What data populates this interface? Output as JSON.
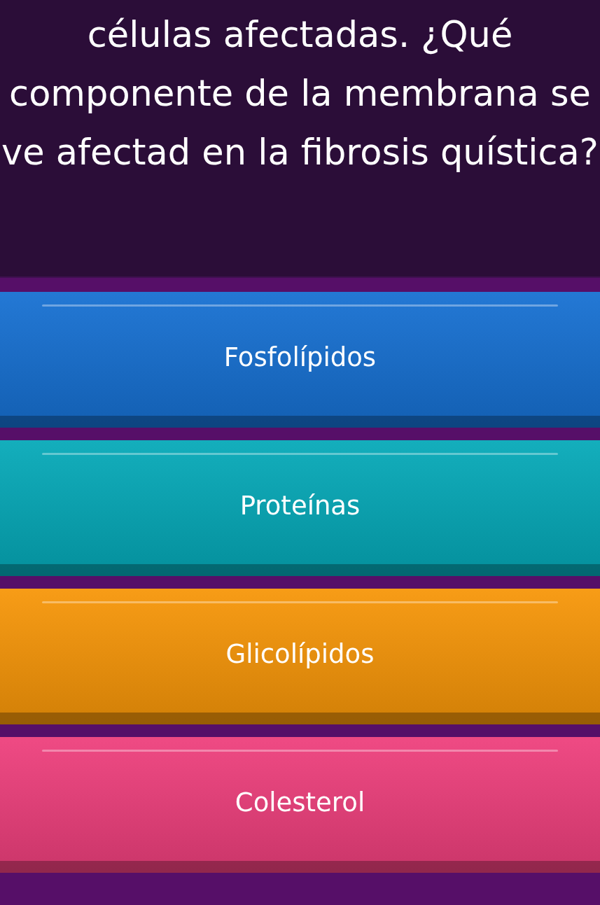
{
  "question": "células afectadas. ¿Qué componente de la membrana se ve afectad en la fibrosis quística?",
  "answers": [
    {
      "label": "Fosfolípidos",
      "color": "#1670d2"
    },
    {
      "label": "Proteínas",
      "color": "#05a9b8"
    },
    {
      "label": "Glicolípidos",
      "color": "#f79608"
    },
    {
      "label": "Colesterol",
      "color": "#ee3f7c"
    }
  ]
}
